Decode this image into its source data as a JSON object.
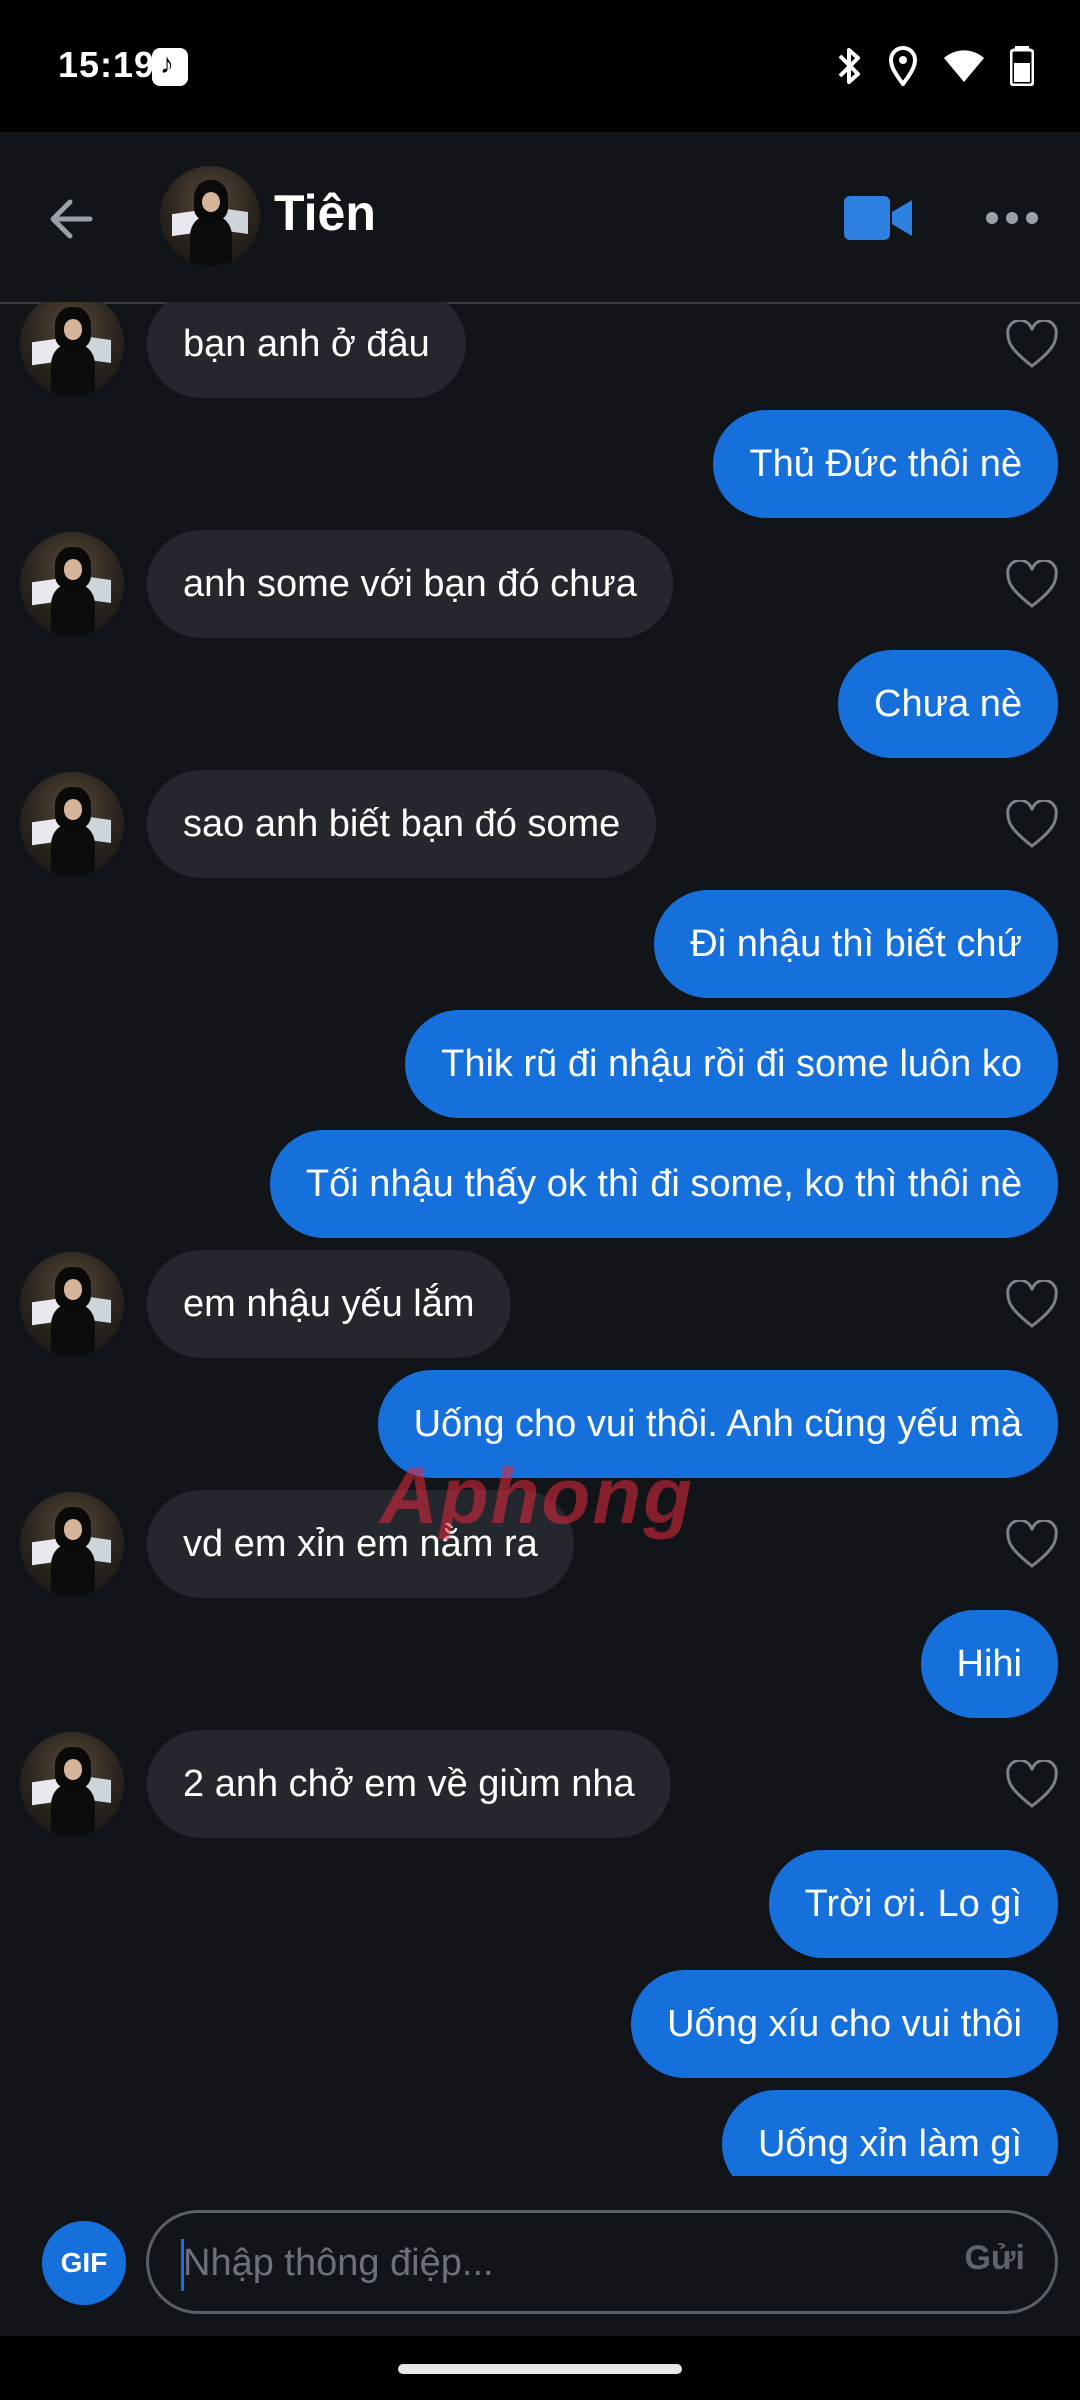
{
  "status_bar": {
    "time": "15:19",
    "icons": [
      "tiktok-icon",
      "bluetooth-icon",
      "location-icon",
      "wifi-icon",
      "battery-icon"
    ]
  },
  "header": {
    "contact_name": "Tiên",
    "icons": [
      "back-arrow-icon",
      "video-call-icon",
      "more-dots-icon"
    ],
    "accent_color": "#2d7fe0"
  },
  "messages": [
    {
      "side": "in",
      "text": "bạn anh ở đâu"
    },
    {
      "side": "out",
      "text": "Thủ Đức thôi nè"
    },
    {
      "side": "in",
      "text": "anh some với bạn đó chưa"
    },
    {
      "side": "out",
      "text": "Chưa nè"
    },
    {
      "side": "in",
      "text": "sao anh biết bạn đó some"
    },
    {
      "side": "out",
      "text": "Đi nhậu thì biết chứ"
    },
    {
      "side": "out",
      "text": "Thik rũ đi nhậu rồi đi some luôn ko"
    },
    {
      "side": "out",
      "text": "Tối nhậu thấy ok thì đi some, ko thì thôi nè"
    },
    {
      "side": "in",
      "text": "em nhậu yếu lắm"
    },
    {
      "side": "out",
      "text": "Uống cho vui thôi. Anh cũng yếu mà"
    },
    {
      "side": "in",
      "text": "vd em xỉn em nằm ra"
    },
    {
      "side": "out",
      "text": "Hihi"
    },
    {
      "side": "in",
      "text": "2 anh chở em về giùm nha"
    },
    {
      "side": "out",
      "text": "Trời ơi. Lo gì"
    },
    {
      "side": "out",
      "text": "Uống xíu cho vui thôi"
    },
    {
      "side": "out",
      "text": "Uống xỉn làm gì"
    }
  ],
  "watermark": {
    "part1": "Aphong",
    "part2": ""
  },
  "composer": {
    "gif_label": "GIF",
    "placeholder": "Nhập thông điệp...",
    "send_label": "Gửi"
  },
  "colors": {
    "background": "#111418",
    "incoming_bubble": "#24272d",
    "outgoing_bubble": "#1670dc"
  }
}
